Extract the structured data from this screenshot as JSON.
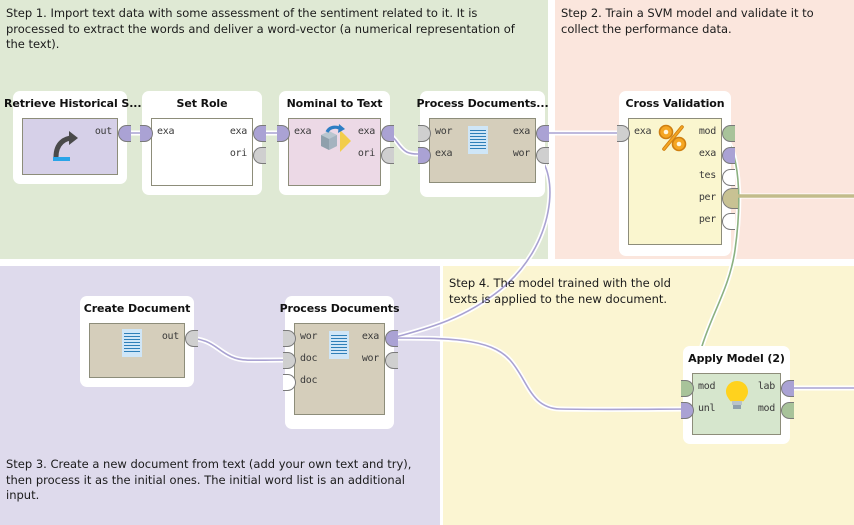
{
  "panels": {
    "step1": {
      "note": "Step 1. Import text data with some assessment of the sentiment related to it. It is processed to extract the words and deliver a word-vector (a numerical representation of the text).",
      "color": "#dfe9d4"
    },
    "step2": {
      "note": "Step 2. Train a SVM model and validate it to collect the performance data.",
      "color": "#fbe6dd"
    },
    "step3": {
      "note": "Step 3. Create a new document from text (add your own text and try), then process it as the initial ones. The initial word list is an additional input.",
      "color": "#dedaec"
    },
    "step4": {
      "note": "Step 4. The model trained with the old texts is applied to the new document.",
      "color": "#fbf5d2"
    }
  },
  "operators": [
    {
      "id": "retrieve-historical-s",
      "title": "Retrieve Historical S...",
      "icon": "retrieve-icon",
      "inputs": [],
      "outputs": [
        "out"
      ]
    },
    {
      "id": "set-role",
      "title": "Set Role",
      "icon": "set-role-icon",
      "inputs": [
        "exa"
      ],
      "outputs": [
        "exa",
        "ori"
      ]
    },
    {
      "id": "nominal-to-text",
      "title": "Nominal to Text",
      "icon": "cube-arrow-icon",
      "inputs": [
        "exa"
      ],
      "outputs": [
        "exa",
        "ori"
      ]
    },
    {
      "id": "process-documents-top",
      "title": "Process Documents...",
      "icon": "document-icon",
      "inputs": [
        "wor",
        "exa"
      ],
      "outputs": [
        "exa",
        "wor"
      ]
    },
    {
      "id": "cross-validation",
      "title": "Cross Validation",
      "icon": "percent-icon",
      "inputs": [
        "exa"
      ],
      "outputs": [
        "mod",
        "exa",
        "tes",
        "per",
        "per"
      ]
    },
    {
      "id": "create-document",
      "title": "Create Document",
      "icon": "document-icon",
      "inputs": [],
      "outputs": [
        "out"
      ]
    },
    {
      "id": "process-documents-bottom",
      "title": "Process Documents",
      "icon": "document-icon",
      "inputs": [
        "wor",
        "doc",
        "doc"
      ],
      "outputs": [
        "exa",
        "wor"
      ]
    },
    {
      "id": "apply-model-2",
      "title": "Apply Model (2)",
      "icon": "lightbulb-icon",
      "inputs": [
        "mod",
        "unl"
      ],
      "outputs": [
        "lab",
        "mod"
      ]
    }
  ],
  "colors": {
    "wire_data": "#a9a2d2",
    "wire_model": "#8bb181",
    "wire_performance": "#c2bc8a",
    "node_retrieve": "#d6d0e8",
    "node_plain": "#ffffff",
    "node_nominal": "#ecd9e6",
    "node_document": "#d5cebb",
    "node_crossval": "#faf6cf",
    "node_apply": "#d6e6cd"
  }
}
